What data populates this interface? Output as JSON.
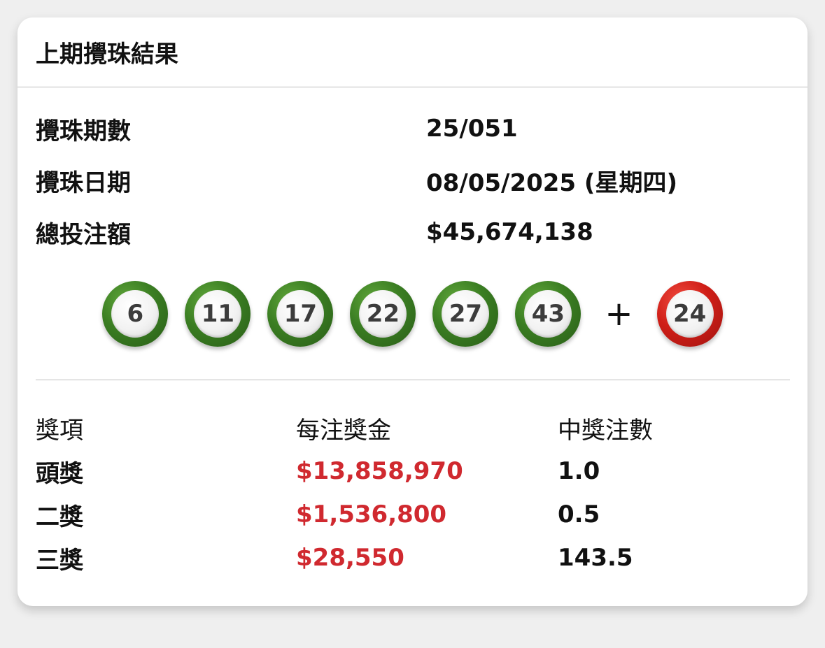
{
  "header": {
    "title": "上期攪珠結果"
  },
  "info": [
    {
      "label": "攪珠期數",
      "value": "25/051"
    },
    {
      "label": "攪珠日期",
      "value": "08/05/2025 (星期四)"
    },
    {
      "label": "總投注額",
      "value": "$45,674,138"
    }
  ],
  "draw": {
    "numbers": [
      "6",
      "11",
      "17",
      "22",
      "27",
      "43"
    ],
    "plus": "+",
    "extra": "24"
  },
  "colors": {
    "number_ball": "#3a7d22",
    "extra_ball": "#cf1e17",
    "prize_amount": "#d0292f"
  },
  "prizes": {
    "headers": [
      "獎項",
      "每注獎金",
      "中獎注數"
    ],
    "rows": [
      {
        "name": "頭獎",
        "amount": "$13,858,970",
        "winners": "1.0"
      },
      {
        "name": "二獎",
        "amount": "$1,536,800",
        "winners": "0.5"
      },
      {
        "name": "三獎",
        "amount": "$28,550",
        "winners": "143.5"
      }
    ]
  }
}
